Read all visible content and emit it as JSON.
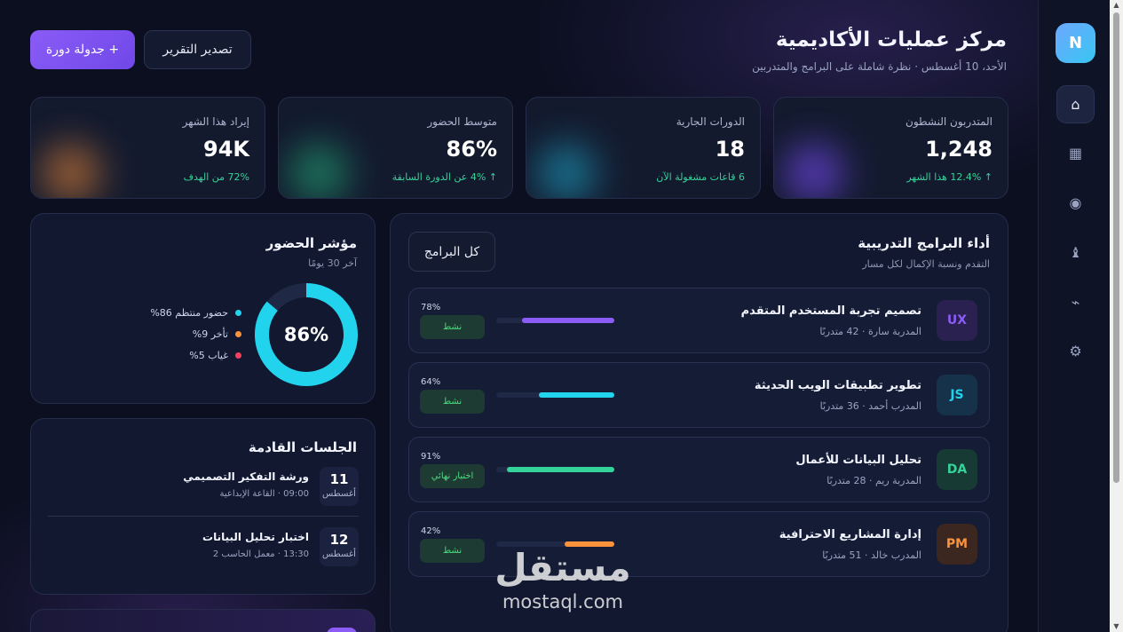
{
  "header": {
    "title": "مركز عمليات الأكاديمية",
    "subtitle": "الأحد، 10 أغسطس · نظرة شاملة على البرامج والمتدربين",
    "primary_button": "+ جدولة دورة",
    "secondary_button": "تصدير التقرير"
  },
  "sidebar": {
    "logo": "N",
    "items": [
      {
        "icon": "home-icon",
        "glyph": "⌂",
        "active": true
      },
      {
        "icon": "grid-icon",
        "glyph": "▦",
        "active": false
      },
      {
        "icon": "target-icon",
        "glyph": "◉",
        "active": false
      },
      {
        "icon": "user-icon",
        "glyph": "♝",
        "active": false
      },
      {
        "icon": "bolt-icon",
        "glyph": "⌁",
        "active": false
      },
      {
        "icon": "settings-icon",
        "glyph": "⚙",
        "active": false
      }
    ]
  },
  "stats": [
    {
      "label": "المتدربون النشطون",
      "value": "1,248",
      "delta": "↑ 12.4% هذا الشهر",
      "color": "#7c4dff"
    },
    {
      "label": "الدورات الجارية",
      "value": "18",
      "delta": "6 قاعات مشغولة الآن",
      "color": "#1ea2c4"
    },
    {
      "label": "متوسط الحضور",
      "value": "86%",
      "delta": "↑ 4% عن الدورة السابقة",
      "color": "#23a877"
    },
    {
      "label": "إيراد هذا الشهر",
      "value": "94K",
      "delta": "72% من الهدف",
      "color": "#e2843a"
    }
  ],
  "attendance": {
    "title": "مؤشر الحضور",
    "subtitle": "آخر 30 يومًا",
    "center_value": "86%",
    "percent": 86,
    "legend": [
      {
        "label": "حضور منتظم 86%",
        "color": "#22d3ee"
      },
      {
        "label": "تأخر 9%",
        "color": "#fb923c"
      },
      {
        "label": "غياب 5%",
        "color": "#f43f5e"
      }
    ]
  },
  "sessions": {
    "title": "الجلسات القادمة",
    "items": [
      {
        "day": "11",
        "month": "أغسطس",
        "name": "ورشة التفكير التصميمي",
        "meta": "09:00 · القاعة الإبداعية"
      },
      {
        "day": "12",
        "month": "أغسطس",
        "name": "اختبار تحليل البيانات",
        "meta": "13:30 · معمل الحاسب 2"
      }
    ]
  },
  "programs": {
    "title": "أداء البرامج التدريبية",
    "subtitle": "التقدم ونسبة الإكمال لكل مسار",
    "filter_button": "كل البرامج",
    "items": [
      {
        "code": "UX",
        "name": "تصميم تجربة المستخدم المتقدم",
        "meta": "المدربة سارة · 42 متدربًا",
        "percent_label": "78%",
        "progress": 0.78,
        "status": "نشط",
        "color": "#8b5cf6",
        "icon_bg": "#2b2150"
      },
      {
        "code": "JS",
        "name": "تطوير تطبيقات الويب الحديثة",
        "meta": "المدرب أحمد · 36 متدربًا",
        "percent_label": "64%",
        "progress": 0.64,
        "status": "نشط",
        "color": "#22d3ee",
        "icon_bg": "#16324a"
      },
      {
        "code": "DA",
        "name": "تحليل البيانات للأعمال",
        "meta": "المدربة ريم · 28 متدربًا",
        "percent_label": "91%",
        "progress": 0.91,
        "status": "اختبار نهائي",
        "color": "#34d399",
        "icon_bg": "#173a34"
      },
      {
        "code": "PM",
        "name": "إدارة المشاريع الاحترافية",
        "meta": "المدرب خالد · 51 متدربًا",
        "percent_label": "42%",
        "progress": 0.42,
        "status": "نشط",
        "color": "#fb923c",
        "icon_bg": "#3b2620"
      }
    ]
  },
  "watermark": {
    "arabic": "مستقل",
    "latin": "mostaql.com"
  }
}
